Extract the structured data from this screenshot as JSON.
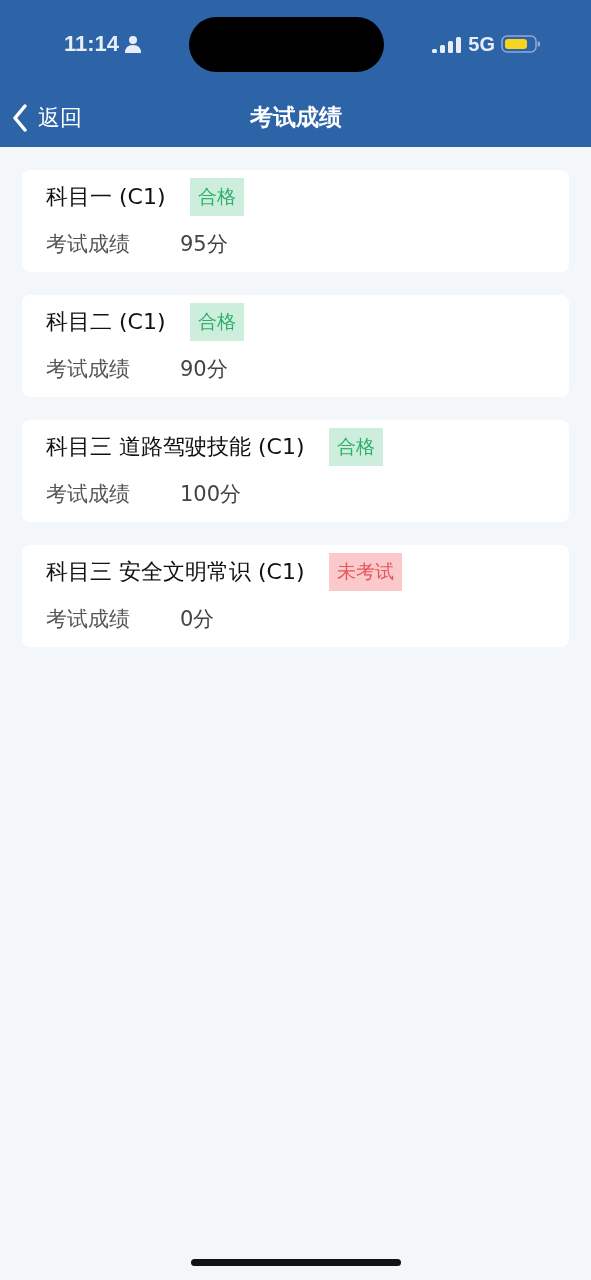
{
  "status_bar": {
    "time": "11:14",
    "network": "5G"
  },
  "nav": {
    "back": "返回",
    "title": "考试成绩"
  },
  "subjects": [
    {
      "name": "科目一 (C1)",
      "status": {
        "label": "合格",
        "kind": "passed"
      },
      "score_label": "考试成绩",
      "score": "95分"
    },
    {
      "name": "科目二 (C1)",
      "status": {
        "label": "合格",
        "kind": "passed"
      },
      "score_label": "考试成绩",
      "score": "90分"
    },
    {
      "name": "科目三 道路驾驶技能 (C1)",
      "status": {
        "label": "合格",
        "kind": "passed"
      },
      "score_label": "考试成绩",
      "score": "100分"
    },
    {
      "name": "科目三 安全文明常识 (C1)",
      "status": {
        "label": "未考试",
        "kind": "not_taken"
      },
      "score_label": "考试成绩",
      "score": "0分"
    }
  ]
}
